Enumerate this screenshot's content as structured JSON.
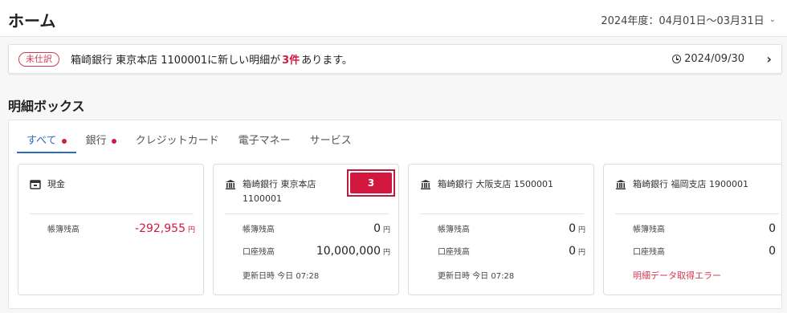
{
  "header": {
    "title": "ホーム",
    "period": "2024年度：04月01日〜03月31日",
    "period_chevron": "chevron-down-icon"
  },
  "notice": {
    "badge": "未仕訳",
    "text_before": "箱崎銀行 東京本店 1100001に新しい明細が",
    "count": "3件",
    "text_after": "あります。",
    "date": "2024/09/30",
    "icons": {
      "clock": "clock-icon",
      "chevron": "chevron-right-icon"
    }
  },
  "section": {
    "title": "明細ボックス"
  },
  "tabs": [
    {
      "label": "すべて",
      "active": true,
      "dot": true
    },
    {
      "label": "銀行",
      "active": false,
      "dot": true
    },
    {
      "label": "クレジットカード",
      "active": false,
      "dot": false
    },
    {
      "label": "電子マネー",
      "active": false,
      "dot": false
    },
    {
      "label": "サービス",
      "active": false,
      "dot": false
    }
  ],
  "cards": [
    {
      "icon": "cash-register-icon",
      "name": "現金",
      "book_label": "帳簿残高",
      "book_value": "-292,955",
      "yen": "円"
    },
    {
      "icon": "bank-icon",
      "name_line1": "箱崎銀行 東京本店",
      "name_line2": "1100001",
      "badge_count": "3",
      "book_label": "帳簿残高",
      "book_value": "0",
      "account_label": "口座残高",
      "account_value": "10,000,000",
      "yen": "円",
      "updated": "更新日時 今日 07:28"
    },
    {
      "icon": "bank-icon",
      "name": "箱崎銀行 大阪支店 1500001",
      "book_label": "帳簿残高",
      "book_value": "0",
      "account_label": "口座残高",
      "account_value": "0",
      "yen": "円",
      "updated": "更新日時 今日 07:28"
    },
    {
      "icon": "bank-icon",
      "name": "箱崎銀行 福岡支店 1900001",
      "book_label": "帳簿残高",
      "book_value": "0",
      "account_label": "口座残高",
      "account_value": "0",
      "error": "明細データ取得エラー"
    }
  ],
  "colors": {
    "accent": "#2b6cc4",
    "alert": "#d3183f"
  }
}
